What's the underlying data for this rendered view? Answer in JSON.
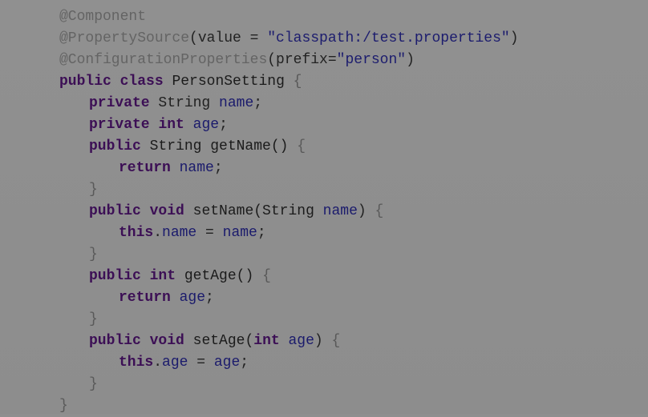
{
  "code": {
    "lines": [
      {
        "indent": 0,
        "tokens": [
          {
            "text": "@Component",
            "kind": "ann"
          }
        ]
      },
      {
        "indent": 0,
        "tokens": [
          {
            "text": "@PropertySource",
            "kind": "ann"
          },
          {
            "text": "(value = ",
            "kind": "punc"
          },
          {
            "text": "\"classpath:/test.properties\"",
            "kind": "str"
          },
          {
            "text": ")",
            "kind": "punc"
          }
        ]
      },
      {
        "indent": 0,
        "tokens": [
          {
            "text": "@ConfigurationProperties",
            "kind": "ann"
          },
          {
            "text": "(prefix=",
            "kind": "punc"
          },
          {
            "text": "\"person\"",
            "kind": "str"
          },
          {
            "text": ")",
            "kind": "punc"
          }
        ]
      },
      {
        "indent": 0,
        "tokens": [
          {
            "text": "public",
            "kind": "kw"
          },
          {
            "text": " ",
            "kind": "punc"
          },
          {
            "text": "class",
            "kind": "kw"
          },
          {
            "text": " PersonSetting ",
            "kind": "ident"
          },
          {
            "text": "{",
            "kind": "brace"
          }
        ]
      },
      {
        "indent": 1,
        "tokens": [
          {
            "text": "private",
            "kind": "kw"
          },
          {
            "text": " String ",
            "kind": "type"
          },
          {
            "text": "name",
            "kind": "field"
          },
          {
            "text": ";",
            "kind": "punc"
          }
        ]
      },
      {
        "indent": 1,
        "tokens": [
          {
            "text": "private",
            "kind": "kw"
          },
          {
            "text": " ",
            "kind": "punc"
          },
          {
            "text": "int",
            "kind": "kw"
          },
          {
            "text": " ",
            "kind": "punc"
          },
          {
            "text": "age",
            "kind": "field"
          },
          {
            "text": ";",
            "kind": "punc"
          }
        ]
      },
      {
        "indent": 1,
        "tokens": [
          {
            "text": "public",
            "kind": "kw"
          },
          {
            "text": " String getName() ",
            "kind": "ident"
          },
          {
            "text": "{",
            "kind": "brace"
          }
        ]
      },
      {
        "indent": 2,
        "tokens": [
          {
            "text": "return",
            "kind": "kw"
          },
          {
            "text": " ",
            "kind": "punc"
          },
          {
            "text": "name",
            "kind": "field"
          },
          {
            "text": ";",
            "kind": "punc"
          }
        ]
      },
      {
        "indent": 1,
        "tokens": [
          {
            "text": "}",
            "kind": "brace"
          }
        ]
      },
      {
        "indent": 1,
        "tokens": [
          {
            "text": "public",
            "kind": "kw"
          },
          {
            "text": " ",
            "kind": "punc"
          },
          {
            "text": "void",
            "kind": "kw"
          },
          {
            "text": " setName(String ",
            "kind": "ident"
          },
          {
            "text": "name",
            "kind": "field"
          },
          {
            "text": ") ",
            "kind": "punc"
          },
          {
            "text": "{",
            "kind": "brace"
          }
        ]
      },
      {
        "indent": 2,
        "tokens": [
          {
            "text": "this",
            "kind": "kw"
          },
          {
            "text": ".",
            "kind": "punc"
          },
          {
            "text": "name",
            "kind": "field"
          },
          {
            "text": " = ",
            "kind": "punc"
          },
          {
            "text": "name",
            "kind": "field"
          },
          {
            "text": ";",
            "kind": "punc"
          }
        ]
      },
      {
        "indent": 1,
        "tokens": [
          {
            "text": "}",
            "kind": "brace"
          }
        ]
      },
      {
        "indent": 1,
        "tokens": [
          {
            "text": "public",
            "kind": "kw"
          },
          {
            "text": " ",
            "kind": "punc"
          },
          {
            "text": "int",
            "kind": "kw"
          },
          {
            "text": " getAge() ",
            "kind": "ident"
          },
          {
            "text": "{",
            "kind": "brace"
          }
        ]
      },
      {
        "indent": 2,
        "tokens": [
          {
            "text": "return",
            "kind": "kw"
          },
          {
            "text": " ",
            "kind": "punc"
          },
          {
            "text": "age",
            "kind": "field"
          },
          {
            "text": ";",
            "kind": "punc"
          }
        ]
      },
      {
        "indent": 1,
        "tokens": [
          {
            "text": "}",
            "kind": "brace"
          }
        ]
      },
      {
        "indent": 1,
        "tokens": [
          {
            "text": "public",
            "kind": "kw"
          },
          {
            "text": " ",
            "kind": "punc"
          },
          {
            "text": "void",
            "kind": "kw"
          },
          {
            "text": " setAge(",
            "kind": "ident"
          },
          {
            "text": "int",
            "kind": "kw"
          },
          {
            "text": " ",
            "kind": "punc"
          },
          {
            "text": "age",
            "kind": "field"
          },
          {
            "text": ") ",
            "kind": "punc"
          },
          {
            "text": "{",
            "kind": "brace"
          }
        ]
      },
      {
        "indent": 2,
        "tokens": [
          {
            "text": "this",
            "kind": "kw"
          },
          {
            "text": ".",
            "kind": "punc"
          },
          {
            "text": "age",
            "kind": "field"
          },
          {
            "text": " = ",
            "kind": "punc"
          },
          {
            "text": "age",
            "kind": "field"
          },
          {
            "text": ";",
            "kind": "punc"
          }
        ]
      },
      {
        "indent": 1,
        "tokens": [
          {
            "text": "}",
            "kind": "brace"
          }
        ]
      },
      {
        "indent": 0,
        "tokens": [
          {
            "text": "}",
            "kind": "brace"
          }
        ]
      }
    ]
  }
}
